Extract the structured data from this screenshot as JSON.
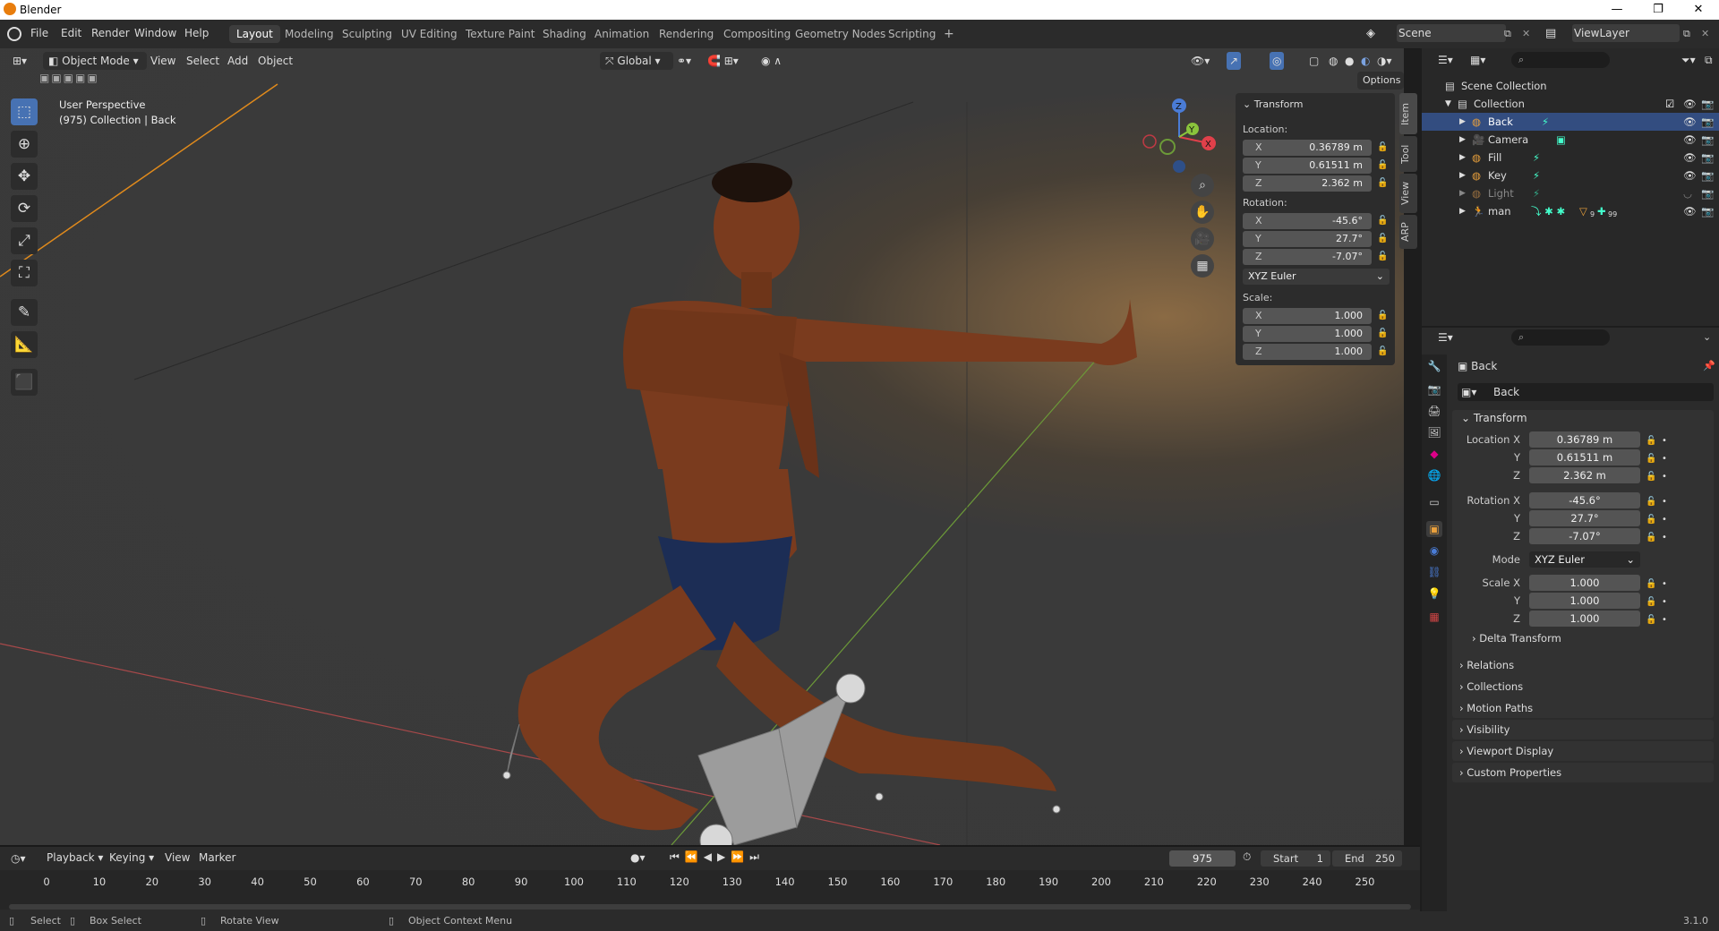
{
  "window": {
    "title": "Blender",
    "minimize": "—",
    "restore": "❐",
    "close": "✕"
  },
  "menu": [
    "File",
    "Edit",
    "Render",
    "Window",
    "Help"
  ],
  "workspaces": [
    "Layout",
    "Modeling",
    "Sculpting",
    "UV Editing",
    "Texture Paint",
    "Shading",
    "Animation",
    "Rendering",
    "Compositing",
    "Geometry Nodes",
    "Scripting"
  ],
  "add_workspace": "+",
  "scene": "Scene",
  "view_layer": "ViewLayer",
  "viewport": {
    "mode": "Object Mode",
    "menus": [
      "View",
      "Select",
      "Add",
      "Object"
    ],
    "orientation": "Global",
    "options": "Options",
    "overlay_line1": "User Perspective",
    "overlay_line2": "(975) Collection | Back",
    "gizmo_axes": {
      "x": "X",
      "y": "Y",
      "z": "Z"
    }
  },
  "npanel": {
    "header": "Transform",
    "location_label": "Location:",
    "location": [
      {
        "axis": "X",
        "value": "0.36789 m"
      },
      {
        "axis": "Y",
        "value": "0.61511 m"
      },
      {
        "axis": "Z",
        "value": "2.362 m"
      }
    ],
    "rotation_label": "Rotation:",
    "rotation": [
      {
        "axis": "X",
        "value": "-45.6°"
      },
      {
        "axis": "Y",
        "value": "27.7°"
      },
      {
        "axis": "Z",
        "value": "-7.07°"
      }
    ],
    "mode": "XYZ Euler",
    "scale_label": "Scale:",
    "scale": [
      {
        "axis": "X",
        "value": "1.000"
      },
      {
        "axis": "Y",
        "value": "1.000"
      },
      {
        "axis": "Z",
        "value": "1.000"
      }
    ],
    "tabs": [
      "Item",
      "Tool",
      "View",
      "ARP"
    ]
  },
  "outliner": {
    "scene_collection": "Scene Collection",
    "collection": "Collection",
    "items": [
      {
        "name": "Back",
        "selected": true
      },
      {
        "name": "Camera",
        "selected": false
      },
      {
        "name": "Fill",
        "selected": false
      },
      {
        "name": "Key",
        "selected": false
      },
      {
        "name": "Light",
        "selected": false
      },
      {
        "name": "man",
        "selected": false
      }
    ],
    "man_badges": [
      "9",
      "99"
    ]
  },
  "properties": {
    "object_name": "Back",
    "data_name": "Back",
    "transform_header": "Transform",
    "location_x_label": "Location X",
    "rotation_x_label": "Rotation X",
    "scale_x_label": "Scale X",
    "y_label": "Y",
    "z_label": "Z",
    "mode_label": "Mode",
    "location": [
      "0.36789 m",
      "0.61511 m",
      "2.362 m"
    ],
    "rotation": [
      "-45.6°",
      "27.7°",
      "-7.07°"
    ],
    "mode": "XYZ Euler",
    "scale": [
      "1.000",
      "1.000",
      "1.000"
    ],
    "delta_transform": "Delta Transform",
    "panels": [
      "Relations",
      "Collections",
      "Motion Paths",
      "Visibility",
      "Viewport Display",
      "Custom Properties"
    ]
  },
  "timeline": {
    "menus": [
      "Playback",
      "Keying",
      "View",
      "Marker"
    ],
    "current_frame": "975",
    "start_label": "Start",
    "start": "1",
    "end_label": "End",
    "end": "250",
    "ticks": [
      "0",
      "10",
      "20",
      "30",
      "40",
      "50",
      "60",
      "70",
      "80",
      "90",
      "100",
      "110",
      "120",
      "130",
      "140",
      "150",
      "160",
      "170",
      "180",
      "190",
      "200",
      "210",
      "220",
      "230",
      "240",
      "250"
    ]
  },
  "statusbar": {
    "select": "Select",
    "box_select": "Box Select",
    "rotate_view": "Rotate View",
    "context_menu": "Object Context Menu",
    "version": "3.1.0"
  },
  "colors": {
    "accent": "#4772b3",
    "selection": "#334d80",
    "x_axis": "#e0404a",
    "y_axis": "#8ac43c",
    "z_axis": "#4a7cd6",
    "orange": "#e87d0d"
  }
}
